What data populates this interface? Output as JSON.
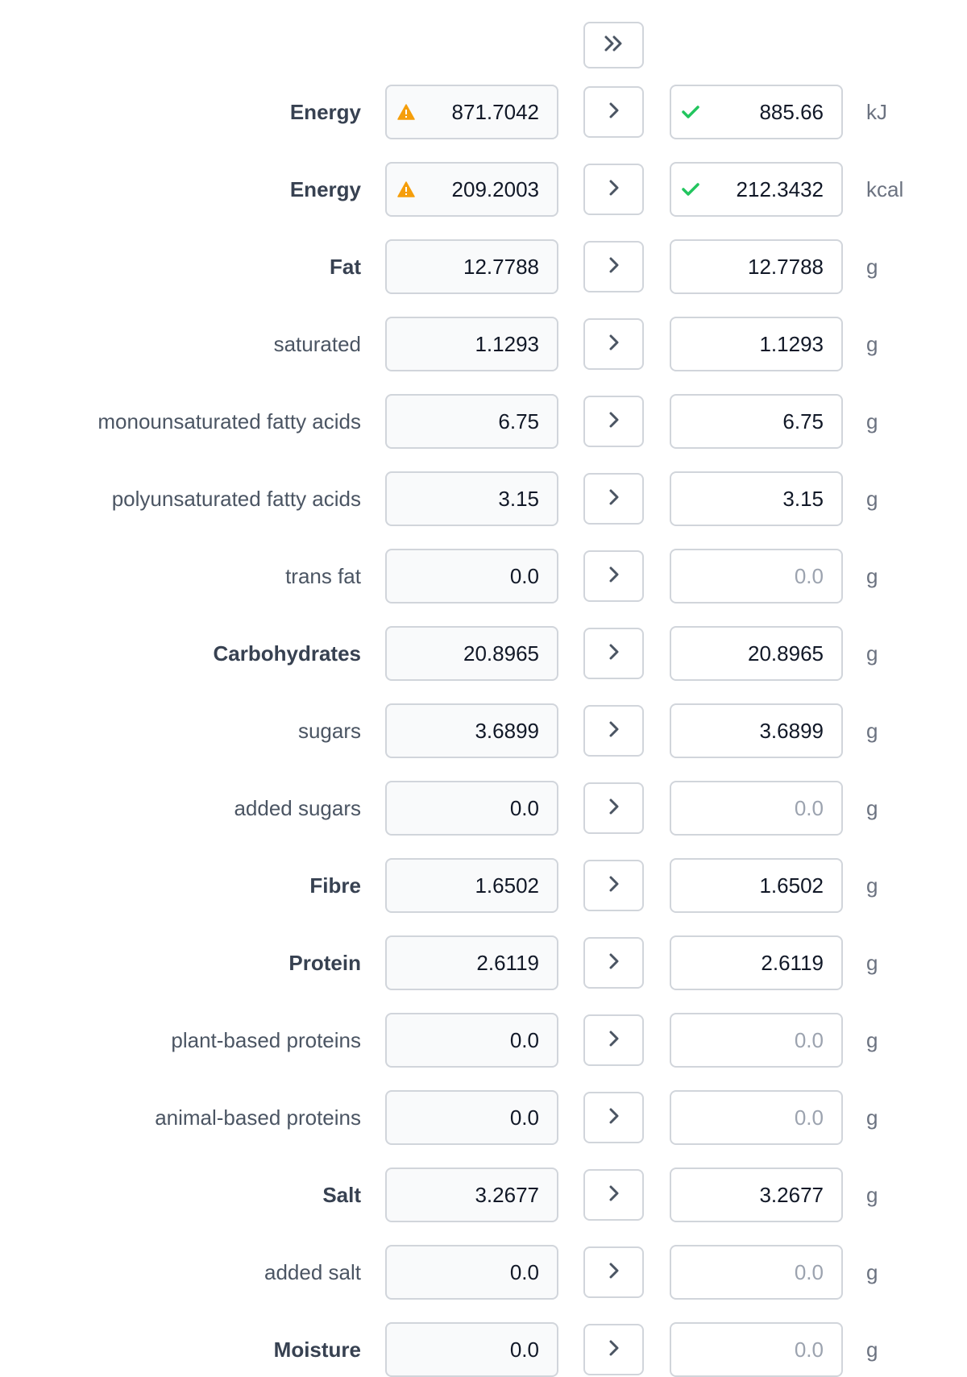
{
  "colors": {
    "warning": "#f59e0b",
    "success": "#22c55e",
    "border": "#d1d5db",
    "placeholder": "#9ca3af"
  },
  "copy_all_icon": "chevron-double-right-icon",
  "rows": [
    {
      "label": "Energy",
      "bold": true,
      "source": "871.7042",
      "source_icon": "warning-icon",
      "target": "885.66",
      "target_is_placeholder": false,
      "target_icon": "check-icon",
      "unit": "kJ"
    },
    {
      "label": "Energy",
      "bold": true,
      "source": "209.2003",
      "source_icon": "warning-icon",
      "target": "212.3432",
      "target_is_placeholder": false,
      "target_icon": "check-icon",
      "unit": "kcal"
    },
    {
      "label": "Fat",
      "bold": true,
      "source": "12.7788",
      "source_icon": null,
      "target": "12.7788",
      "target_is_placeholder": false,
      "target_icon": null,
      "unit": "g"
    },
    {
      "label": "saturated",
      "bold": false,
      "source": "1.1293",
      "source_icon": null,
      "target": "1.1293",
      "target_is_placeholder": false,
      "target_icon": null,
      "unit": "g"
    },
    {
      "label": "monounsaturated fatty acids",
      "bold": false,
      "source": "6.75",
      "source_icon": null,
      "target": "6.75",
      "target_is_placeholder": false,
      "target_icon": null,
      "unit": "g"
    },
    {
      "label": "polyunsaturated fatty acids",
      "bold": false,
      "source": "3.15",
      "source_icon": null,
      "target": "3.15",
      "target_is_placeholder": false,
      "target_icon": null,
      "unit": "g"
    },
    {
      "label": "trans fat",
      "bold": false,
      "source": "0.0",
      "source_icon": null,
      "target": "0.0",
      "target_is_placeholder": true,
      "target_icon": null,
      "unit": "g"
    },
    {
      "label": "Carbohydrates",
      "bold": true,
      "source": "20.8965",
      "source_icon": null,
      "target": "20.8965",
      "target_is_placeholder": false,
      "target_icon": null,
      "unit": "g"
    },
    {
      "label": "sugars",
      "bold": false,
      "source": "3.6899",
      "source_icon": null,
      "target": "3.6899",
      "target_is_placeholder": false,
      "target_icon": null,
      "unit": "g"
    },
    {
      "label": "added sugars",
      "bold": false,
      "source": "0.0",
      "source_icon": null,
      "target": "0.0",
      "target_is_placeholder": true,
      "target_icon": null,
      "unit": "g"
    },
    {
      "label": "Fibre",
      "bold": true,
      "source": "1.6502",
      "source_icon": null,
      "target": "1.6502",
      "target_is_placeholder": false,
      "target_icon": null,
      "unit": "g"
    },
    {
      "label": "Protein",
      "bold": true,
      "source": "2.6119",
      "source_icon": null,
      "target": "2.6119",
      "target_is_placeholder": false,
      "target_icon": null,
      "unit": "g"
    },
    {
      "label": "plant-based proteins",
      "bold": false,
      "source": "0.0",
      "source_icon": null,
      "target": "0.0",
      "target_is_placeholder": true,
      "target_icon": null,
      "unit": "g"
    },
    {
      "label": "animal-based proteins",
      "bold": false,
      "source": "0.0",
      "source_icon": null,
      "target": "0.0",
      "target_is_placeholder": true,
      "target_icon": null,
      "unit": "g"
    },
    {
      "label": "Salt",
      "bold": true,
      "source": "3.2677",
      "source_icon": null,
      "target": "3.2677",
      "target_is_placeholder": false,
      "target_icon": null,
      "unit": "g"
    },
    {
      "label": "added salt",
      "bold": false,
      "source": "0.0",
      "source_icon": null,
      "target": "0.0",
      "target_is_placeholder": true,
      "target_icon": null,
      "unit": "g"
    },
    {
      "label": "Moisture",
      "bold": true,
      "source": "0.0",
      "source_icon": null,
      "target": "0.0",
      "target_is_placeholder": true,
      "target_icon": null,
      "unit": "g"
    }
  ]
}
